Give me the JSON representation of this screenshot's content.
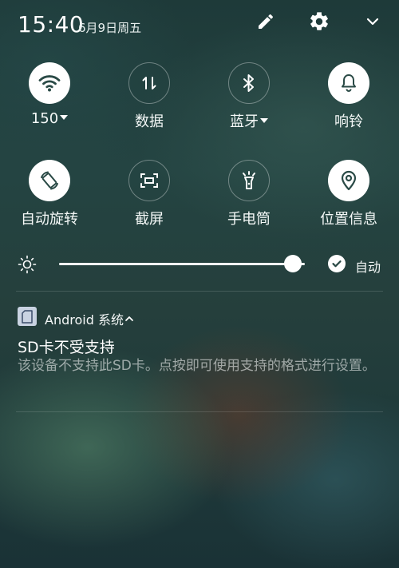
{
  "status_bar": {
    "time": "15:40",
    "date": "6月9日周五",
    "icons": [
      "edit-icon",
      "settings-icon",
      "collapse-icon"
    ]
  },
  "quick_settings": {
    "row1": [
      {
        "label": "150",
        "icon": "wifi-icon",
        "active": true,
        "dropdown": true
      },
      {
        "label": "数据",
        "icon": "data-icon",
        "active": false,
        "dropdown": false
      },
      {
        "label": "蓝牙",
        "icon": "bluetooth-icon",
        "active": false,
        "dropdown": true
      },
      {
        "label": "响铃",
        "icon": "bell-icon",
        "active": true,
        "dropdown": false
      }
    ],
    "row2": [
      {
        "label": "自动旋转",
        "icon": "rotate-icon",
        "active": true
      },
      {
        "label": "截屏",
        "icon": "screenshot-icon",
        "active": false
      },
      {
        "label": "手电筒",
        "icon": "flashlight-icon",
        "active": false
      },
      {
        "label": "位置信息",
        "icon": "location-icon",
        "active": true
      }
    ]
  },
  "brightness": {
    "level": 0.95,
    "auto_label": "自动",
    "auto_enabled": true
  },
  "notification": {
    "app_name": "Android 系统",
    "title": "SD卡不受支持",
    "body": "该设备不支持此SD卡。点按即可使用支持的格式进行设置。"
  },
  "colors": {
    "accent": "#ffffff",
    "active_icon": "#2a4a46",
    "app_icon_bg": "#c9d3e2"
  }
}
